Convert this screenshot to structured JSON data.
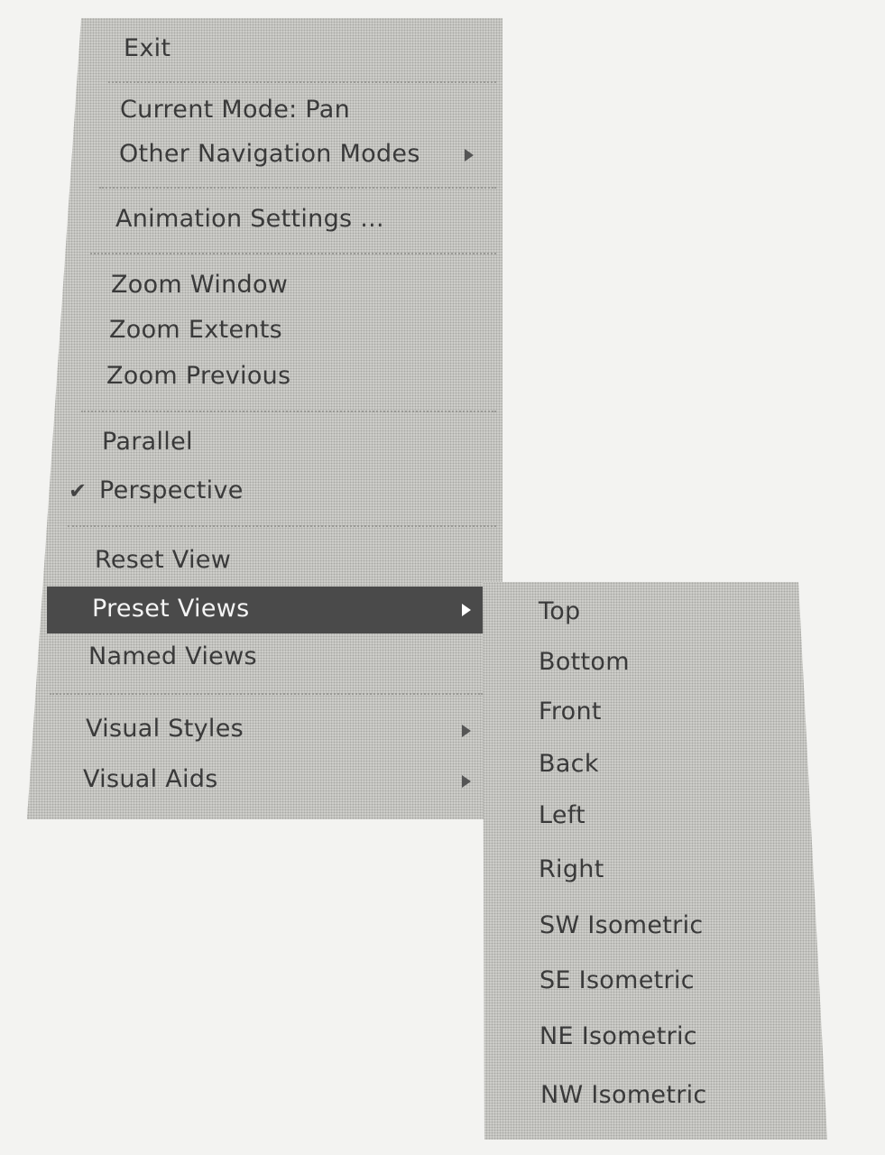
{
  "main_menu": {
    "items": [
      {
        "label": "Exit"
      },
      {
        "label": "Current Mode: Pan"
      },
      {
        "label": "Other Navigation Modes",
        "submenu": true
      },
      {
        "label": "Animation Settings ..."
      },
      {
        "label": "Zoom Window"
      },
      {
        "label": "Zoom Extents"
      },
      {
        "label": "Zoom Previous"
      },
      {
        "label": "Parallel"
      },
      {
        "label": "Perspective",
        "checked": true
      },
      {
        "label": "Reset View"
      },
      {
        "label": "Preset Views",
        "submenu": true,
        "highlighted": true
      },
      {
        "label": "Named Views"
      },
      {
        "label": "Visual Styles",
        "submenu": true
      },
      {
        "label": "Visual Aids",
        "submenu": true
      }
    ],
    "check_icon": "✔"
  },
  "preset_views_submenu": {
    "items": [
      {
        "label": "Top"
      },
      {
        "label": "Bottom"
      },
      {
        "label": "Front"
      },
      {
        "label": "Back"
      },
      {
        "label": "Left"
      },
      {
        "label": "Right"
      },
      {
        "label": "SW Isometric"
      },
      {
        "label": "SE Isometric"
      },
      {
        "label": "NE Isometric"
      },
      {
        "label": "NW Isometric"
      }
    ]
  },
  "colors": {
    "menu_bg": "#cfcfcb",
    "highlight": "#4a4a4a",
    "text": "#3a3a3a"
  }
}
